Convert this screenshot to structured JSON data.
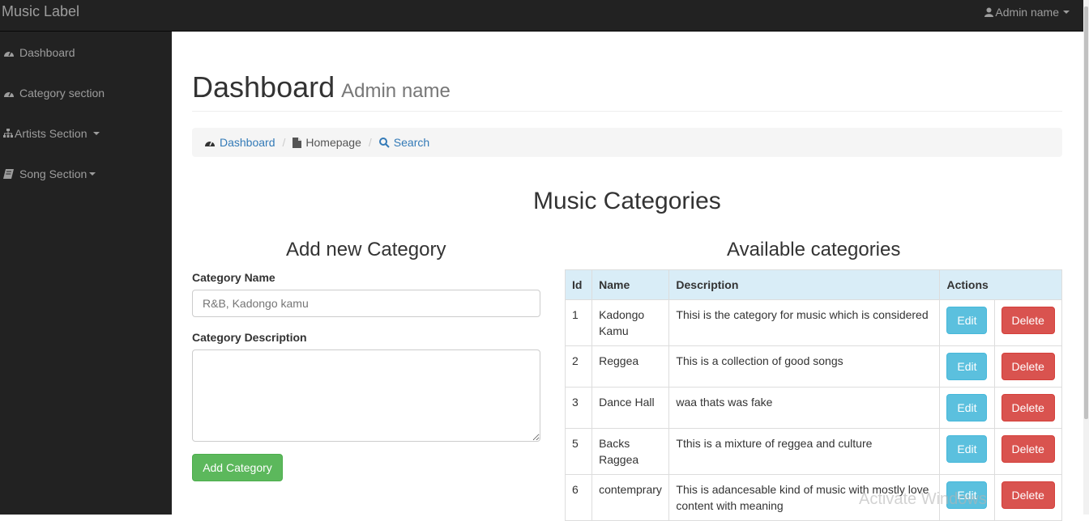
{
  "topbar": {
    "brand": "Music Label",
    "user_label": "Admin name"
  },
  "sidebar": {
    "items": [
      {
        "label": "Dashboard",
        "icon": "dashboard-icon",
        "has_dropdown": false
      },
      {
        "label": "Category section",
        "icon": "dashboard-icon",
        "has_dropdown": false
      },
      {
        "label": "Artists Section",
        "icon": "sitemap-icon",
        "has_dropdown": true
      },
      {
        "label": "Song Section",
        "icon": "book-icon",
        "has_dropdown": true
      }
    ]
  },
  "header": {
    "title": "Dashboard",
    "subtitle": "Admin name"
  },
  "breadcrumb": [
    {
      "label": "Dashboard",
      "icon": "dashboard-icon"
    },
    {
      "label": "Homepage",
      "icon": "file-icon"
    },
    {
      "label": "Search",
      "icon": "search-icon"
    }
  ],
  "main": {
    "title": "Music Categories",
    "form": {
      "title": "Add new Category",
      "name_label": "Category Name",
      "name_placeholder": "R&B, Kadongo kamu",
      "name_value": "",
      "desc_label": "Category Description",
      "desc_value": "",
      "submit_label": "Add Category"
    },
    "table": {
      "title": "Available categories",
      "headers": [
        "Id",
        "Name",
        "Description",
        "Actions"
      ],
      "edit_label": "Edit",
      "delete_label": "Delete",
      "rows": [
        {
          "id": "1",
          "name": "Kadongo Kamu",
          "description": "Thisi is the category for music which is considered"
        },
        {
          "id": "2",
          "name": "Reggea",
          "description": "This is a collection of good songs"
        },
        {
          "id": "3",
          "name": "Dance Hall",
          "description": "waa thats was fake"
        },
        {
          "id": "5",
          "name": "Backs Raggea",
          "description": "Tthis is a mixture of reggea and culture"
        },
        {
          "id": "6",
          "name": "contemprary",
          "description": "This is adancesable kind of music with mostly love content with meaning"
        }
      ]
    }
  },
  "watermark": "Activate Windows",
  "colors": {
    "accent": "#337ab7",
    "success": "#5cb85c",
    "info": "#5bc0de",
    "danger": "#d9534f",
    "navbar": "#222222"
  }
}
